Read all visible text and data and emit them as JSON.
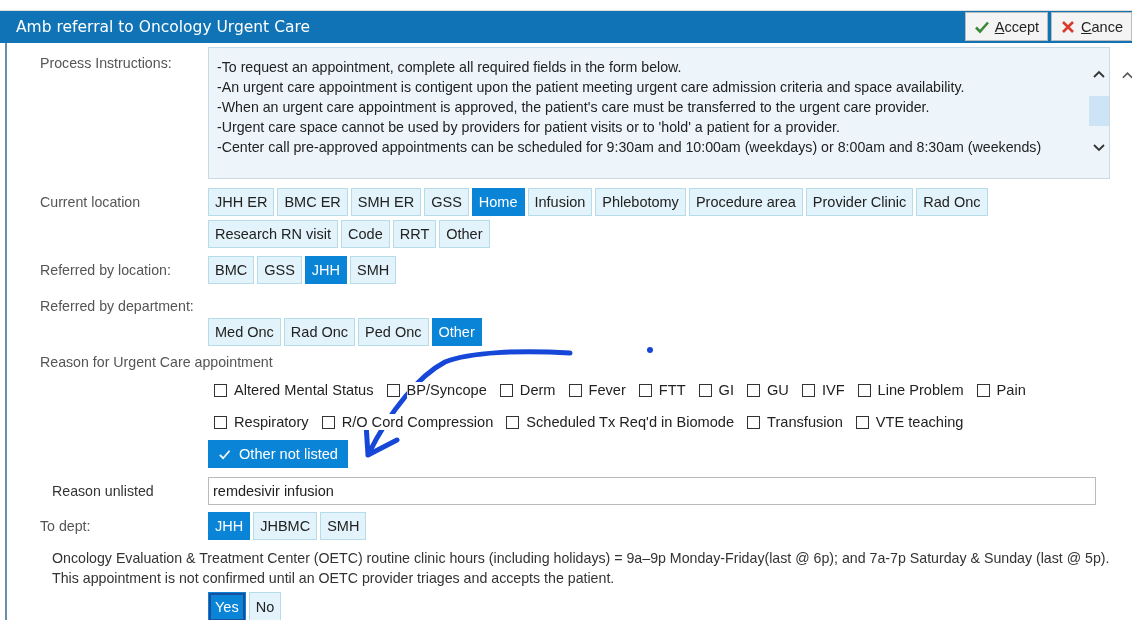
{
  "window": {
    "title": "Amb referral to Oncology Urgent Care"
  },
  "toolbar": [
    {
      "label": "Accept",
      "kind": "accept"
    },
    {
      "label": "Cance",
      "kind": "cancel"
    }
  ],
  "instructions": {
    "label": "Process Instructions:",
    "lines": [
      "-To request an appointment, complete all required fields in the form below.",
      "-An urgent care appointment is contigent upon the patient meeting urgent care admission criteria and space availability.",
      "-When an urgent care appointment is approved, the patient's care must be transferred to the urgent care provider.",
      "-Urgent care space cannot be used by providers for patient visits or to 'hold' a patient for a provider.",
      "-Center call pre-approved appointments can be scheduled for 9:30am and 10:00am (weekdays) or 8:00am and 8:30am (weekends)"
    ]
  },
  "current_location": {
    "label": "Current location",
    "options": [
      {
        "label": "JHH ER",
        "selected": false
      },
      {
        "label": "BMC ER",
        "selected": false
      },
      {
        "label": "SMH ER",
        "selected": false
      },
      {
        "label": "GSS",
        "selected": false
      },
      {
        "label": "Home",
        "selected": true
      },
      {
        "label": "Infusion",
        "selected": false
      },
      {
        "label": "Phlebotomy",
        "selected": false
      },
      {
        "label": "Procedure area",
        "selected": false
      },
      {
        "label": "Provider Clinic",
        "selected": false
      },
      {
        "label": "Rad Onc",
        "selected": false
      },
      {
        "label": "Research RN visit",
        "selected": false
      },
      {
        "label": "Code",
        "selected": false
      },
      {
        "label": "RRT",
        "selected": false
      },
      {
        "label": "Other",
        "selected": false
      }
    ]
  },
  "referred_by_location": {
    "label": "Referred by location:",
    "options": [
      {
        "label": "BMC",
        "selected": false
      },
      {
        "label": "GSS",
        "selected": false
      },
      {
        "label": "JHH",
        "selected": true
      },
      {
        "label": "SMH",
        "selected": false
      }
    ]
  },
  "referred_by_department": {
    "label": "Referred by department:",
    "options": [
      {
        "label": "Med Onc",
        "selected": false
      },
      {
        "label": "Rad Onc",
        "selected": false
      },
      {
        "label": "Ped Onc",
        "selected": false
      },
      {
        "label": "Other",
        "selected": true
      }
    ]
  },
  "reason": {
    "label": "Reason for Urgent Care appointment",
    "options": [
      {
        "label": "Altered Mental Status",
        "checked": false
      },
      {
        "label": "BP/Syncope",
        "checked": false
      },
      {
        "label": "Derm",
        "checked": false
      },
      {
        "label": "Fever",
        "checked": false
      },
      {
        "label": "FTT",
        "checked": false
      },
      {
        "label": "GI",
        "checked": false
      },
      {
        "label": "GU",
        "checked": false
      },
      {
        "label": "IVF",
        "checked": false
      },
      {
        "label": "Line Problem",
        "checked": false
      },
      {
        "label": "Pain",
        "checked": false
      },
      {
        "label": "Respiratory",
        "checked": false
      },
      {
        "label": "R/O Cord Compression",
        "checked": false
      },
      {
        "label": "Scheduled Tx Req'd in Biomode",
        "checked": false
      },
      {
        "label": "Transfusion",
        "checked": false
      },
      {
        "label": "VTE teaching",
        "checked": false
      }
    ],
    "other": {
      "label": "Other not listed",
      "checked": true
    }
  },
  "reason_unlisted": {
    "label": "Reason unlisted",
    "value": "remdesivir infusion"
  },
  "to_dept": {
    "label": "To dept:",
    "options": [
      {
        "label": "JHH",
        "selected": true
      },
      {
        "label": "JHBMC",
        "selected": false
      },
      {
        "label": "SMH",
        "selected": false
      }
    ]
  },
  "notice": {
    "text": "Oncology Evaluation & Treatment Center (OETC) routine clinic hours (including holidays) = 9a–9p Monday-Friday(last @ 6p); and 7a-7p Saturday & Sunday (last @ 5p). This appointment is not confirmed until an OETC provider triages and accepts the patient.",
    "options": [
      {
        "label": "Yes",
        "selected": true
      },
      {
        "label": "No",
        "selected": false
      }
    ]
  }
}
